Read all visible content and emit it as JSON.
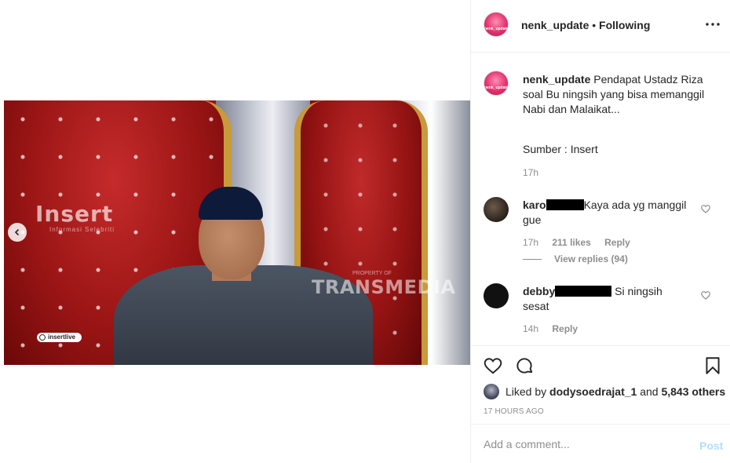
{
  "post": {
    "username": "nenk_update",
    "separator": "•",
    "follow_status": "Following",
    "avatar_text": "nenk_update"
  },
  "video": {
    "watermark_insert": "Insert",
    "watermark_insert_sub": "Informasi Selebriti",
    "watermark_trans": "TRANSMEDIA",
    "watermark_property": "PROPERTY OF",
    "live_tag": "insertlive"
  },
  "caption": {
    "username": "nenk_update",
    "text": "Pendapat Ustadz Riza soal Bu ningsih yang bisa memanggil Nabi dan Malaikat...",
    "source": "Sumber : Insert",
    "time": "17h"
  },
  "comments": [
    {
      "username_visible": "karo",
      "text": "Kaya ada yg manggil gue",
      "time": "17h",
      "likes": "211 likes",
      "reply_label": "Reply",
      "view_replies": "View replies (94)"
    },
    {
      "username_visible": "debby",
      "text": "Si ningsih sesat",
      "time": "14h",
      "reply_label": "Reply"
    }
  ],
  "likes_summary": {
    "prefix": "Liked by",
    "user": "dodysoedrajat_1",
    "conj": "and",
    "others": "5,843 others"
  },
  "timestamp": "17 HOURS AGO",
  "comment_box": {
    "placeholder": "Add a comment...",
    "post_label": "Post"
  },
  "colors": {
    "text": "#262626",
    "secondary": "#8e8e8e",
    "post_disabled": "#b2dffc",
    "divider": "#efefef"
  }
}
